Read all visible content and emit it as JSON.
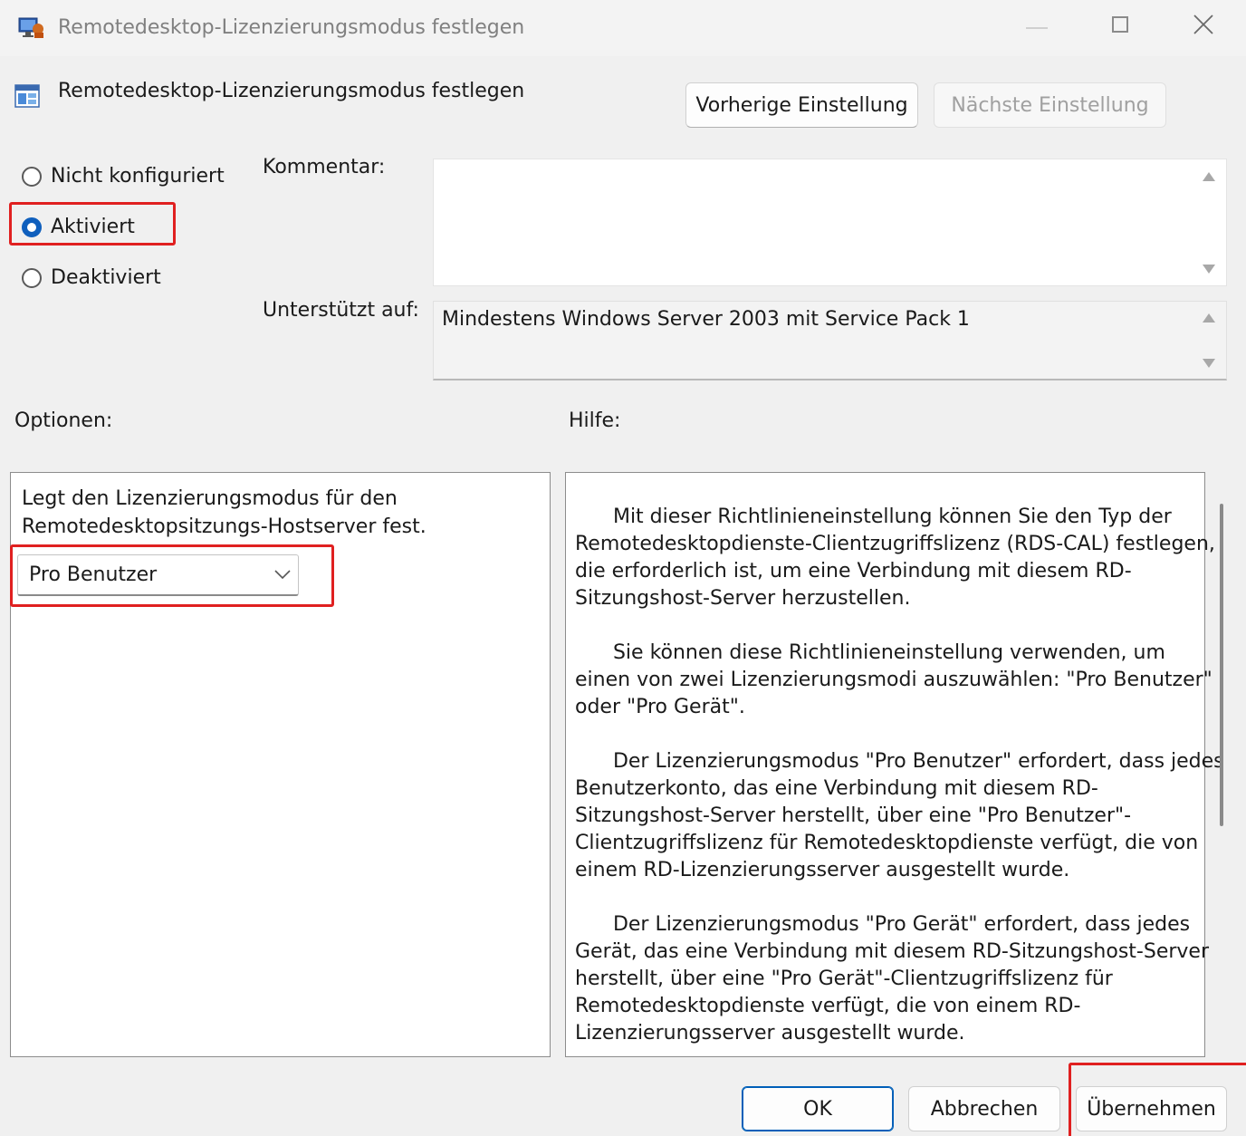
{
  "window": {
    "title": "Remotedesktop-Lizenzierungsmodus festlegen"
  },
  "header": {
    "policy_title": "Remotedesktop-Lizenzierungsmodus festlegen",
    "prev_label": "Vorherige Einstellung",
    "next_label": "Nächste Einstellung"
  },
  "state": {
    "options": [
      {
        "label": "Nicht konfiguriert",
        "checked": false
      },
      {
        "label": "Aktiviert",
        "checked": true
      },
      {
        "label": "Deaktiviert",
        "checked": false
      }
    ]
  },
  "comment": {
    "label": "Kommentar:",
    "value": ""
  },
  "supported": {
    "label": "Unterstützt auf:",
    "value": "Mindestens Windows Server 2003 mit Service Pack 1"
  },
  "options_panel": {
    "label": "Optionen:",
    "description_lines": [
      "Legt den Lizenzierungsmodus für den",
      "Remotedesktopsitzungs-Hostserver fest."
    ],
    "dropdown_value": "Pro Benutzer"
  },
  "help_panel": {
    "label": "Hilfe:",
    "lines": [
      "      Mit dieser Richtlinieneinstellung können Sie den Typ der",
      "Remotedesktopdienste-Clientzugriffslizenz (RDS-CAL) festlegen,",
      "die erforderlich ist, um eine Verbindung mit diesem RD-",
      "Sitzungshost-Server herzustellen.",
      "      Sie können diese Richtlinieneinstellung verwenden, um",
      "einen von zwei Lizenzierungsmodi auszuwählen: \"Pro Benutzer\"",
      "oder \"Pro Gerät\".",
      "      Der Lizenzierungsmodus \"Pro Benutzer\" erfordert, dass jedes",
      "Benutzerkonto, das eine Verbindung mit diesem RD-",
      "Sitzungshost-Server herstellt, über eine \"Pro Benutzer\"-",
      "Clientzugriffslizenz für Remotedesktopdienste verfügt, die von",
      "einem RD-Lizenzierungsserver ausgestellt wurde.",
      "      Der Lizenzierungsmodus \"Pro Gerät\" erfordert, dass jedes",
      "Gerät, das eine Verbindung mit diesem RD-Sitzungshost-Server",
      "herstellt, über eine \"Pro Gerät\"-Clientzugriffslizenz für",
      "Remotedesktopdienste verfügt, die von einem RD-",
      "Lizenzierungsserver ausgestellt wurde."
    ]
  },
  "footer": {
    "ok_label": "OK",
    "cancel_label": "Abbrechen",
    "apply_label": "Übernehmen"
  },
  "colors": {
    "highlight": "#e02020",
    "accent": "#0f5fbd"
  }
}
